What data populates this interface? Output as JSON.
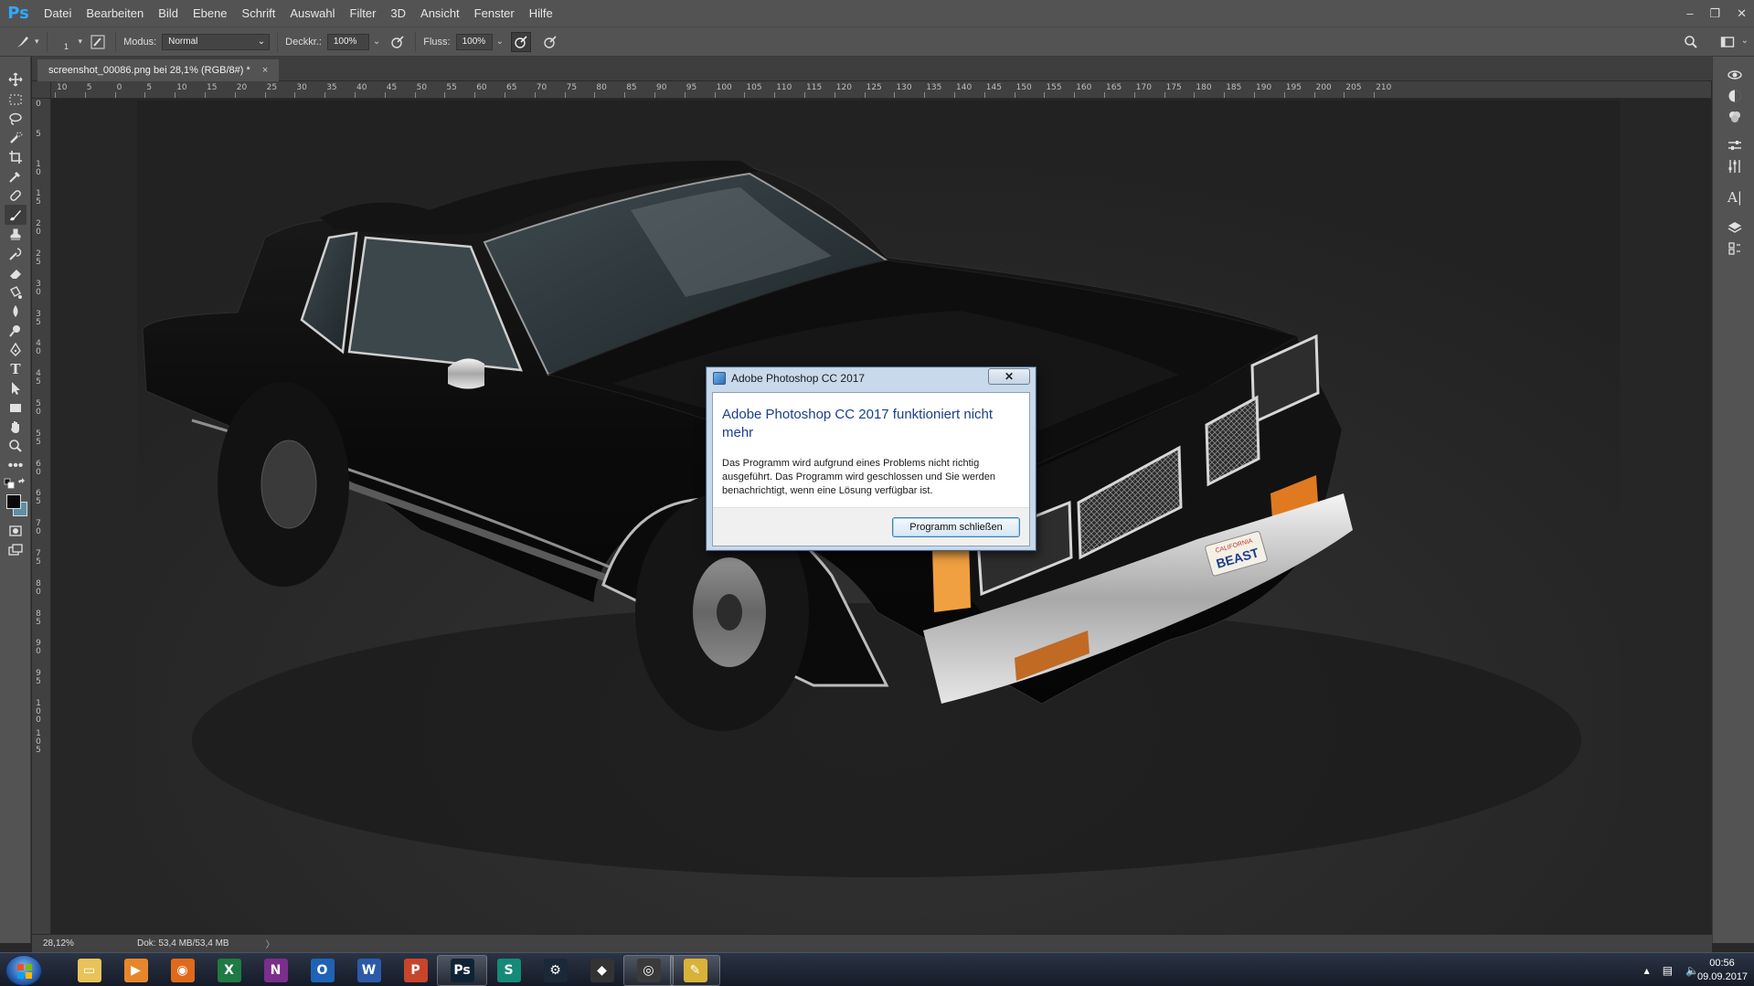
{
  "app": {
    "logo": "Ps"
  },
  "menubar": {
    "items": [
      {
        "label": "Datei"
      },
      {
        "label": "Bearbeiten"
      },
      {
        "label": "Bild"
      },
      {
        "label": "Ebene"
      },
      {
        "label": "Schrift"
      },
      {
        "label": "Auswahl"
      },
      {
        "label": "Filter"
      },
      {
        "label": "3D"
      },
      {
        "label": "Ansicht"
      },
      {
        "label": "Fenster"
      },
      {
        "label": "Hilfe"
      }
    ],
    "window_controls": {
      "minimize": "–",
      "restore": "❐",
      "close": "✕"
    }
  },
  "options": {
    "brush_size": "1",
    "modus_label": "Modus:",
    "modus_value": "Normal",
    "deckkraft_label": "Deckkr.:",
    "deckkraft_value": "100%",
    "fluss_label": "Fluss:",
    "fluss_value": "100%"
  },
  "document": {
    "tab_title": "screenshot_00086.png bei 28,1% (RGB/8#) *",
    "tab_close": "×"
  },
  "ruler": {
    "h_labels": [
      "10",
      "5",
      "0",
      "5",
      "10",
      "15",
      "20",
      "25",
      "30",
      "35",
      "40",
      "45",
      "50",
      "55",
      "60",
      "65",
      "70",
      "75",
      "80",
      "85",
      "90",
      "95",
      "100",
      "105",
      "110",
      "115",
      "120",
      "125",
      "130",
      "135",
      "140",
      "145",
      "150",
      "155",
      "160",
      "165",
      "170",
      "175",
      "180",
      "185",
      "190",
      "195",
      "200",
      "205",
      "210"
    ],
    "v_labels": [
      "0",
      "5",
      "10",
      "15",
      "20",
      "25",
      "30",
      "35",
      "40",
      "45",
      "50",
      "55",
      "60",
      "65",
      "70",
      "75",
      "80",
      "85",
      "90",
      "95",
      "100",
      "105"
    ]
  },
  "status": {
    "zoom": "28,12%",
    "doc_info": "Dok: 53,4 MB/53,4 MB",
    "arrow": "〉"
  },
  "dialog": {
    "title": "Adobe Photoshop CC 2017",
    "close_glyph": "✕",
    "heading": "Adobe Photoshop CC 2017 funktioniert nicht mehr",
    "message": "Das Programm wird aufgrund eines Problems nicht richtig ausgeführt. Das Programm wird geschlossen und Sie werden benachrichtigt, wenn eine Lösung verfügbar ist.",
    "button": "Programm schließen"
  },
  "image": {
    "plate_state": "CALIFORNIA",
    "plate_text": "BEAST"
  },
  "taskbar": {
    "apps": [
      {
        "name": "explorer",
        "glyph": "▭",
        "color": "#e8c35a"
      },
      {
        "name": "media-player",
        "glyph": "▶",
        "color": "#e8862c"
      },
      {
        "name": "firefox",
        "glyph": "◉",
        "color": "#e06a1c"
      },
      {
        "name": "excel",
        "glyph": "X",
        "color": "#1f7a44"
      },
      {
        "name": "onenote",
        "glyph": "N",
        "color": "#7b2e8c"
      },
      {
        "name": "outlook",
        "glyph": "O",
        "color": "#1f63b5"
      },
      {
        "name": "word",
        "glyph": "W",
        "color": "#2b5aa8"
      },
      {
        "name": "powerpoint",
        "glyph": "P",
        "color": "#c7452a"
      },
      {
        "name": "photoshop",
        "glyph": "Ps",
        "color": "#0f2336"
      },
      {
        "name": "sway",
        "glyph": "S",
        "color": "#168a78"
      },
      {
        "name": "steam",
        "glyph": "⚙",
        "color": "#1b2838"
      },
      {
        "name": "unity",
        "glyph": "◆",
        "color": "#333333"
      },
      {
        "name": "obs",
        "glyph": "◎",
        "color": "#3a3a3a"
      },
      {
        "name": "problem-reports",
        "glyph": "✎",
        "color": "#d9b23a"
      }
    ],
    "tray": {
      "chevron": "▴",
      "network": "▤",
      "volume": "🔈"
    },
    "time": "00:56",
    "date": "09.09.2017"
  }
}
